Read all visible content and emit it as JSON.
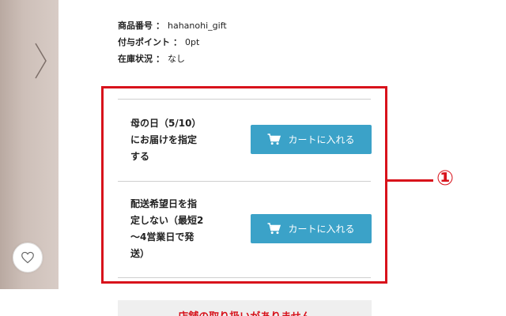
{
  "product_meta": {
    "code_label": "商品番号",
    "code_value": "hahanohi_gift",
    "points_label": "付与ポイント",
    "points_value": "0pt",
    "stock_label": "在庫状況",
    "stock_value": "なし",
    "separator": "："
  },
  "options": [
    {
      "text": "母の日（5/10）\nにお届けを指定\nする",
      "button_label": "カートに入れる"
    },
    {
      "text": "配送希望日を指\n定しない（最短2\n〜4営業日で発\n送）",
      "button_label": "カートに入れる"
    }
  ],
  "callout": {
    "number": "①"
  },
  "notice": {
    "text": "店舗の取り扱いがありません"
  },
  "icons": {
    "carousel_next": "chevron-right-icon",
    "favorite": "heart-icon",
    "cart": "cart-icon"
  },
  "colors": {
    "accent_red": "#d8121b",
    "button_blue": "#3ba2c8"
  }
}
